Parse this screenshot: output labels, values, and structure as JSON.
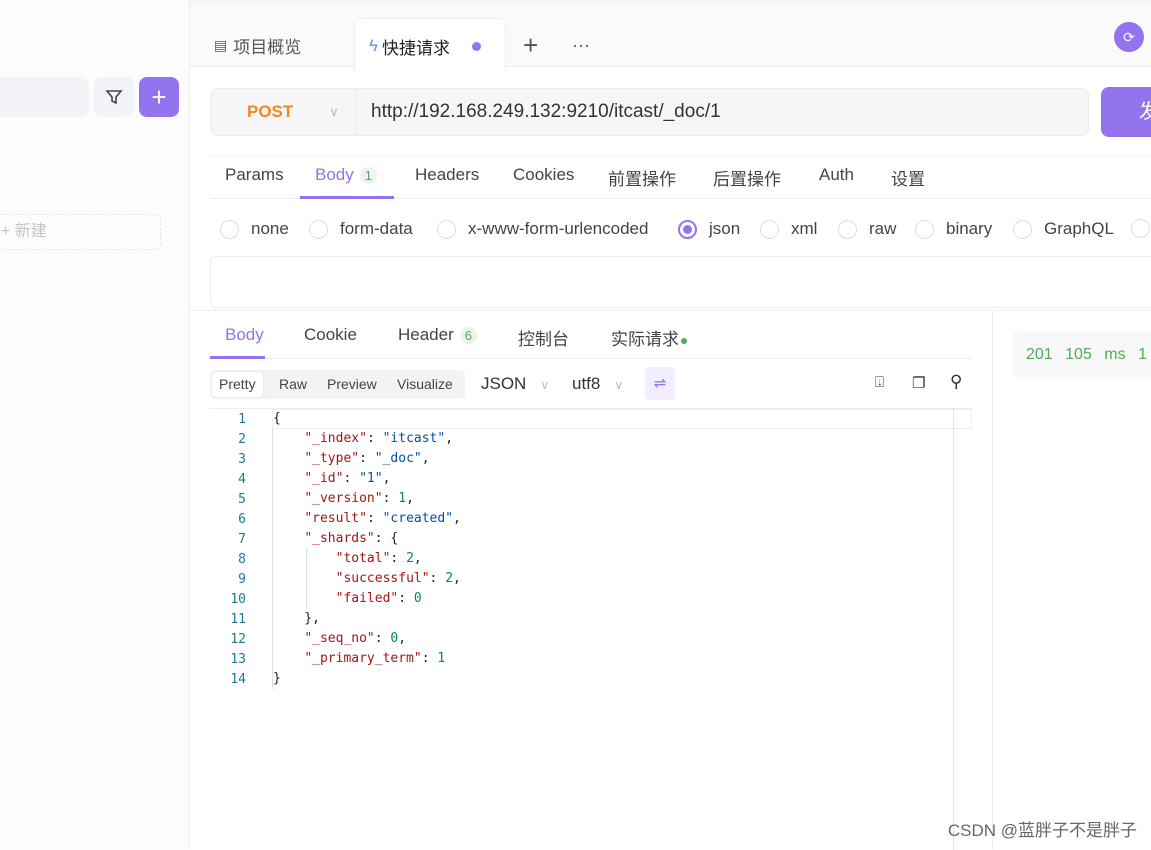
{
  "sidebar": {
    "new_label": "+ 新建"
  },
  "tabs": [
    {
      "label": "项目概览",
      "icon": "layout-icon"
    },
    {
      "label": "快捷请求",
      "icon": "lightning-icon"
    }
  ],
  "request": {
    "method": "POST",
    "url": "http://192.168.249.132:9210/itcast/_doc/1",
    "send_label": "发"
  },
  "req_tabs": [
    "Params",
    "Body",
    "Headers",
    "Cookies",
    "前置操作",
    "后置操作",
    "Auth",
    "设置"
  ],
  "body_badge": "1",
  "body_types": [
    "none",
    "form-data",
    "x-www-form-urlencoded",
    "json",
    "xml",
    "raw",
    "binary",
    "GraphQL"
  ],
  "selected_body_type": "json",
  "resp_tabs": [
    "Body",
    "Cookie",
    "Header",
    "控制台",
    "实际请求"
  ],
  "header_badge": "6",
  "format_buttons": [
    "Pretty",
    "Raw",
    "Preview",
    "Visualize"
  ],
  "format": "JSON",
  "encoding": "utf8",
  "status": {
    "code": "201",
    "time": "105 ms",
    "extra": "1"
  },
  "colors": {
    "accent": "#9373ee",
    "method": "#f0871f",
    "success": "#4caf50"
  },
  "code_lines": [
    [
      [
        "p",
        "{"
      ]
    ],
    [
      [
        "p",
        "    "
      ],
      [
        "k",
        "\"_index\""
      ],
      [
        "p",
        ": "
      ],
      [
        "s",
        "\"itcast\""
      ],
      [
        "p",
        ","
      ]
    ],
    [
      [
        "p",
        "    "
      ],
      [
        "k",
        "\"_type\""
      ],
      [
        "p",
        ": "
      ],
      [
        "s",
        "\"_doc\""
      ],
      [
        "p",
        ","
      ]
    ],
    [
      [
        "p",
        "    "
      ],
      [
        "k",
        "\"_id\""
      ],
      [
        "p",
        ": "
      ],
      [
        "s",
        "\"1\""
      ],
      [
        "p",
        ","
      ]
    ],
    [
      [
        "p",
        "    "
      ],
      [
        "k",
        "\"_version\""
      ],
      [
        "p",
        ": "
      ],
      [
        "n",
        "1"
      ],
      [
        "p",
        ","
      ]
    ],
    [
      [
        "p",
        "    "
      ],
      [
        "k",
        "\"result\""
      ],
      [
        "p",
        ": "
      ],
      [
        "s",
        "\"created\""
      ],
      [
        "p",
        ","
      ]
    ],
    [
      [
        "p",
        "    "
      ],
      [
        "k",
        "\"_shards\""
      ],
      [
        "p",
        ": {"
      ]
    ],
    [
      [
        "p",
        "        "
      ],
      [
        "k",
        "\"total\""
      ],
      [
        "p",
        ": "
      ],
      [
        "n",
        "2"
      ],
      [
        "p",
        ","
      ]
    ],
    [
      [
        "p",
        "        "
      ],
      [
        "k",
        "\"successful\""
      ],
      [
        "p",
        ": "
      ],
      [
        "n",
        "2"
      ],
      [
        "p",
        ","
      ]
    ],
    [
      [
        "p",
        "        "
      ],
      [
        "k",
        "\"failed\""
      ],
      [
        "p",
        ": "
      ],
      [
        "n",
        "0"
      ]
    ],
    [
      [
        "p",
        "    },"
      ]
    ],
    [
      [
        "p",
        "    "
      ],
      [
        "k",
        "\"_seq_no\""
      ],
      [
        "p",
        ": "
      ],
      [
        "n",
        "0"
      ],
      [
        "p",
        ","
      ]
    ],
    [
      [
        "p",
        "    "
      ],
      [
        "k",
        "\"_primary_term\""
      ],
      [
        "p",
        ": "
      ],
      [
        "n",
        "1"
      ]
    ],
    [
      [
        "p",
        "}"
      ]
    ]
  ],
  "watermark": "CSDN @蓝胖子不是胖子"
}
